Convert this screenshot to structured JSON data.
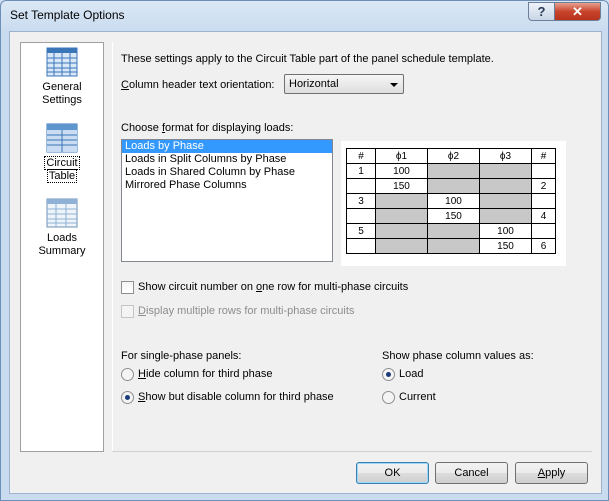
{
  "window": {
    "title": "Set Template Options",
    "help_label": "?",
    "close_label": "✕"
  },
  "sidebar": {
    "items": [
      {
        "label_line1": "General",
        "label_line2": "Settings",
        "icon": "general-settings-icon"
      },
      {
        "label_line1": "Circuit",
        "label_line2": "Table",
        "icon": "circuit-table-icon"
      },
      {
        "label_line1": "Loads",
        "label_line2": "Summary",
        "icon": "loads-summary-icon"
      }
    ],
    "selected": "Circuit Table"
  },
  "main": {
    "intro": "These settings apply to the Circuit Table part of the panel schedule template.",
    "orientation_label_pre": "",
    "orientation_label_u": "C",
    "orientation_label_post": "olumn header text orientation:",
    "orientation_value": "Horizontal",
    "format_label_pre": "Choose ",
    "format_label_u": "f",
    "format_label_post": "ormat for displaying loads:",
    "formats": [
      "Loads by Phase",
      "Loads in Split Columns by Phase",
      "Loads in Shared Column by Phase",
      "Mirrored Phase Columns"
    ],
    "selected_format": "Loads by Phase",
    "preview_table": {
      "headers": [
        "#",
        "ϕ1",
        "ϕ2",
        "ϕ3",
        "#"
      ],
      "rows": [
        [
          "1",
          "100",
          "",
          "",
          ""
        ],
        [
          "",
          "150",
          "",
          "",
          "2"
        ],
        [
          "3",
          "",
          "100",
          "",
          ""
        ],
        [
          "",
          "",
          "150",
          "",
          "4"
        ],
        [
          "5",
          "",
          "",
          "100",
          ""
        ],
        [
          "",
          "",
          "",
          "150",
          "6"
        ]
      ]
    },
    "check_one_row_pre": "Show circuit number on ",
    "check_one_row_u": "o",
    "check_one_row_post": "ne row for multi-phase circuits",
    "check_one_row_checked": false,
    "check_multi_rows_pre": "",
    "check_multi_rows_u": "D",
    "check_multi_rows_post": "isplay multiple rows for multi-phase circuits",
    "check_multi_rows_checked": false,
    "single_phase_label": "For single-phase panels:",
    "radio_hide_pre": "",
    "radio_hide_u": "H",
    "radio_hide_post": "ide column for third phase",
    "radio_show_pre": "",
    "radio_show_u": "S",
    "radio_show_post": "how but disable column for third phase",
    "single_phase_selected": "Show but disable column for third phase",
    "phase_values_label": "Show phase column values as:",
    "radio_load": "Load",
    "radio_current": "Current",
    "phase_values_selected": "Load"
  },
  "footer": {
    "ok_label": "OK",
    "cancel_label": "Cancel",
    "apply_label_u": "A",
    "apply_label_post": "pply"
  }
}
